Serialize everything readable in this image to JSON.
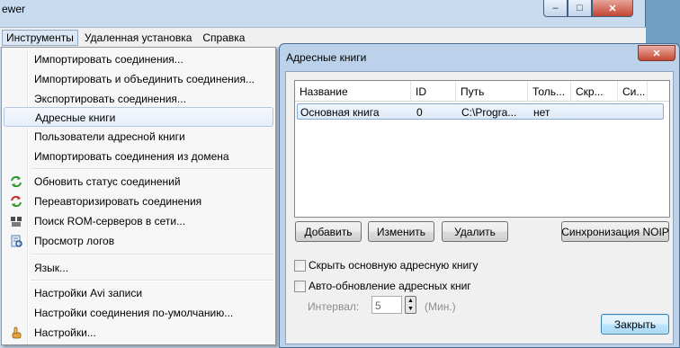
{
  "window": {
    "title": "ewer",
    "caption": {
      "minimize": "‒",
      "maximize": "□",
      "close": "✕"
    }
  },
  "menubar": {
    "items": [
      {
        "label": "Инструменты"
      },
      {
        "label": "Удаленная установка"
      },
      {
        "label": "Справка"
      }
    ]
  },
  "menu": {
    "items": [
      {
        "label": "Импортировать соединения..."
      },
      {
        "label": "Импортировать и объединить соединения..."
      },
      {
        "label": "Экспортировать соединения..."
      },
      {
        "label": "Адресные книги"
      },
      {
        "label": "Пользователи адресной книги"
      },
      {
        "label": "Импортировать соединения из домена"
      },
      {
        "label": "Обновить статус соединений",
        "icon": "refresh-green-icon"
      },
      {
        "label": "Переавторизировать соединения",
        "icon": "refresh-red-icon"
      },
      {
        "label": "Поиск ROM-серверов в сети...",
        "icon": "network-search-icon"
      },
      {
        "label": "Просмотр логов",
        "icon": "log-viewer-icon"
      },
      {
        "label": "Язык..."
      },
      {
        "label": "Настройки Avi записи"
      },
      {
        "label": "Настройки соединения по-умолчанию..."
      },
      {
        "label": "Настройки...",
        "icon": "settings-hand-icon"
      }
    ]
  },
  "dialog": {
    "title": "Адресные книги",
    "close_glyph": "✕",
    "table": {
      "columns": [
        "Название",
        "ID",
        "Путь",
        "Толь...",
        "Скр...",
        "Си..."
      ],
      "rows": [
        [
          "Основная книга",
          "0",
          "C:\\Progra...",
          "нет",
          "",
          ""
        ]
      ]
    },
    "buttons": {
      "add": "Добавить",
      "edit": "Изменить",
      "delete": "Удалить",
      "sync": "Синхронизация NOIP",
      "close": "Закрыть"
    },
    "hide_main_book": "Скрыть основную адресную книгу",
    "auto_update": "Авто-обновление адресных книг",
    "interval_label": "Интервал:",
    "interval_value": "5",
    "interval_unit": "(Мин.)"
  }
}
